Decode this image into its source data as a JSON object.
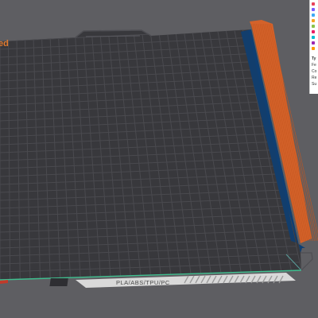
{
  "viewport": {
    "background": "#5e5e62",
    "bed_color": "#38383c",
    "grid_color": "#4a4a4f",
    "bed_label_fragment": "ed",
    "plate_label": "PLA/ABS/TPU/PC",
    "accent_orange": "#d4622a",
    "accent_blue": "#0f3f73",
    "accent_green": "#3fbf8f",
    "accent_red": "#c03a2a"
  },
  "legend": {
    "colors": [
      "#e8425a",
      "#7a5cff",
      "#3fa9f5",
      "#f5a623",
      "#8bc34a",
      "#e91e63",
      "#00bcd4",
      "#9c27b0",
      "#ff9800"
    ],
    "items": [
      {
        "label": "Ty",
        "bold": true
      },
      {
        "label": "Fe"
      },
      {
        "label": "Co"
      },
      {
        "label": "Re"
      },
      {
        "label": "Su"
      }
    ]
  }
}
